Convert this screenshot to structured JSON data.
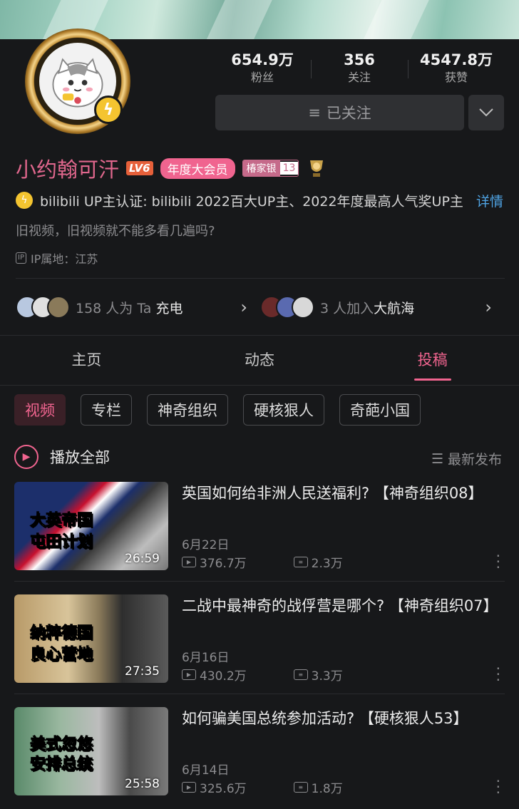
{
  "profile": {
    "name": "小约翰可汗",
    "level": "LV6",
    "vip": "年度大会员",
    "fan_medal_name": "椿家银",
    "fan_medal_level": "13",
    "auth": "bilibili UP主认证: bilibili 2022百大UP主、2022年度最高人气奖UP主",
    "auth_more": "详情",
    "sign": "旧视频，旧视频就不能多看几遍吗?",
    "ip": "IP属地：江苏",
    "ip_icon": "IP"
  },
  "stats": [
    {
      "num": "654.9万",
      "label": "粉丝"
    },
    {
      "num": "356",
      "label": "关注"
    },
    {
      "num": "4547.8万",
      "label": "获赞"
    }
  ],
  "follow": {
    "label": "已关注",
    "menu_icon": "chevron-down-icon"
  },
  "charge": {
    "count": "158 人为 Ta ",
    "action": "充电"
  },
  "crew": {
    "count": "3 人加入",
    "action": "大航海"
  },
  "tabs": [
    "主页",
    "动态",
    "投稿"
  ],
  "chips": [
    "视频",
    "专栏",
    "神奇组织",
    "硬核狠人",
    "奇葩小国"
  ],
  "play_all": "播放全部",
  "sort": "最新发布",
  "videos": [
    {
      "title": "英国如何给非洲人民送福利? 【神奇组织08】",
      "date": "6月22日",
      "views": "376.7万",
      "danmaku": "2.3万",
      "duration": "26:59",
      "cap1a": "大英",
      "cap1b": "帝国",
      "cap2a": "屯田",
      "cap2b": "计划"
    },
    {
      "title": "二战中最神奇的战俘营是哪个? 【神奇组织07】",
      "date": "6月16日",
      "views": "430.2万",
      "danmaku": "3.3万",
      "duration": "27:35",
      "cap1a": "纳粹",
      "cap1b": "德国",
      "cap2a": "良心",
      "cap2b": "营地"
    },
    {
      "title": "如何骗美国总统参加活动? 【硬核狠人53】",
      "date": "6月14日",
      "views": "325.6万",
      "danmaku": "1.8万",
      "duration": "25:58",
      "cap1a": "美式",
      "cap1b": "忽悠",
      "cap2a": "安排",
      "cap2b": "总统"
    }
  ],
  "colors": {
    "accent": "#f0648f",
    "link": "#4fa3e3",
    "background": "#17181a"
  }
}
